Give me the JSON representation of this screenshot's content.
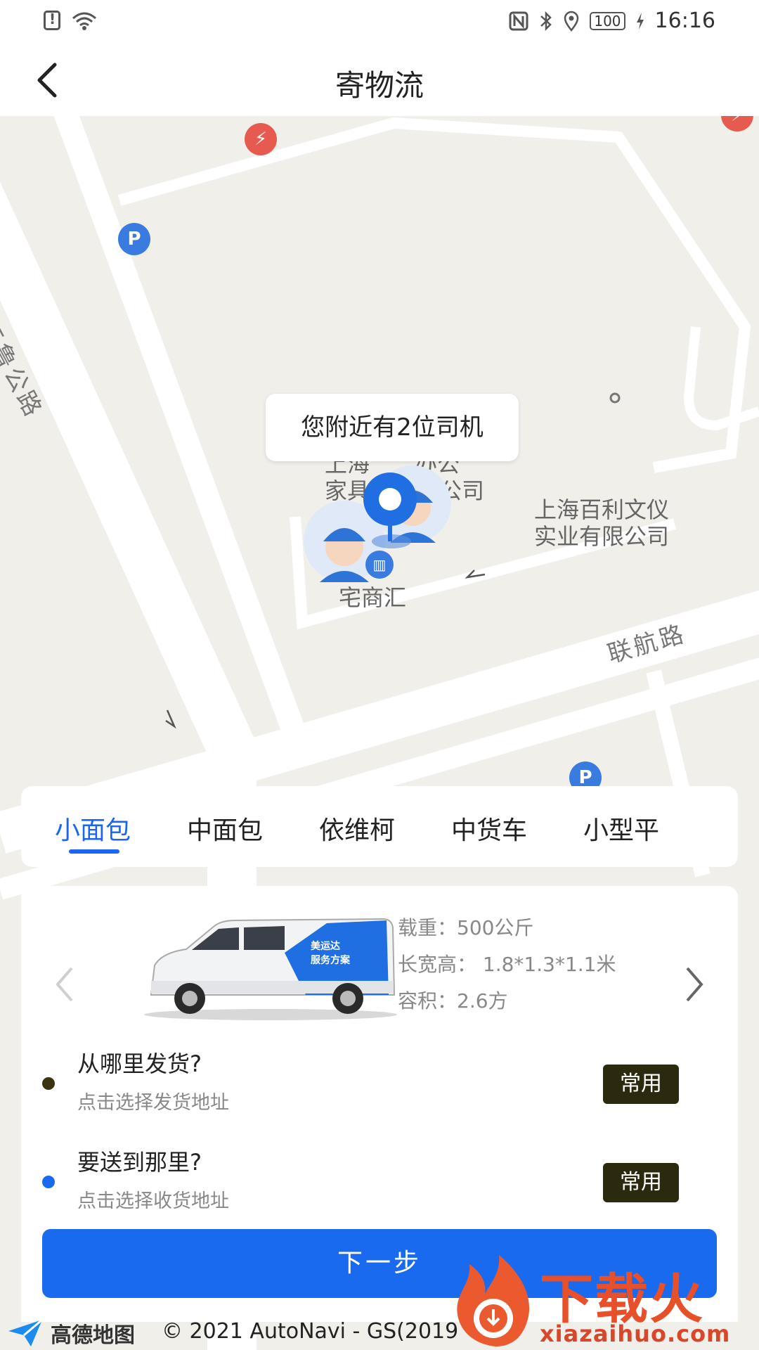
{
  "status_bar": {
    "time": "16:16",
    "battery": "100"
  },
  "nav": {
    "title": "寄物流"
  },
  "map": {
    "tip": "您附近有2位司机",
    "labels": {
      "road_left": "三鲁公路",
      "road_right": "联航路",
      "company_1": "上海百利文仪",
      "company_1b": "实业有限公司",
      "company_2": "上海",
      "company_2b": "办公",
      "company_3": "家具",
      "company_3b": "公司",
      "zhaishanghui": "宅商汇"
    }
  },
  "vehicle_tabs": [
    {
      "label": "小面包",
      "active": true
    },
    {
      "label": "中面包",
      "active": false
    },
    {
      "label": "依维柯",
      "active": false
    },
    {
      "label": "中货车",
      "active": false
    },
    {
      "label": "小型平",
      "active": false
    }
  ],
  "vehicle": {
    "load": "载重：500公斤",
    "dims": "长宽高： 1.8*1.3*1.1米",
    "volume": "容积：2.6方",
    "van_text_1": "美运达",
    "van_text_2": "服务方案"
  },
  "origin": {
    "title": "从哪里发货?",
    "placeholder": "点击选择发货地址",
    "button": "常用"
  },
  "destination": {
    "title": "要送到那里?",
    "placeholder": "点击选择收货地址",
    "button": "常用"
  },
  "next_button": "下一步",
  "attribution": {
    "logo": "高德地图",
    "copyright": "© 2021 AutoNavi - GS(2019"
  },
  "watermark": {
    "text": "下载火",
    "url": "xiazaihuo.com"
  },
  "colors": {
    "accent": "#1a6af0",
    "common_btn": "#2b2a0e",
    "origin_dot": "#3b3410",
    "destination_dot": "#1a6af0"
  }
}
